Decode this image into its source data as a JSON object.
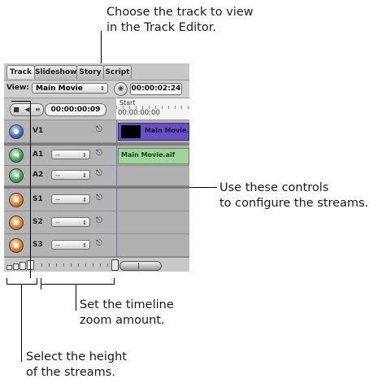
{
  "callouts": {
    "track_editor": [
      "Choose the track to view",
      "in the Track Editor."
    ],
    "configure_streams": [
      "Use these controls",
      "to configure the streams."
    ],
    "zoom": [
      "Set the timeline",
      "zoom amount."
    ],
    "height": [
      "Select the height",
      "of the streams."
    ]
  },
  "tabs": [
    "Track",
    "Slideshow",
    "Story",
    "Script"
  ],
  "view": {
    "label": "View:",
    "selected": "Main Movie",
    "timecode": "00:00:02:24"
  },
  "controls": {
    "timecode": "00:00:00:09"
  },
  "ruler": {
    "start_label": "Start",
    "timecode": "00:00:00:00"
  },
  "tracks": {
    "v1": {
      "name": "V1",
      "clip": "Main Movie.m"
    },
    "a1": {
      "name": "A1",
      "stream": "--",
      "clip": "Main Movie.aif"
    },
    "a2": {
      "name": "A2",
      "stream": "--"
    },
    "s1": {
      "name": "S1",
      "stream": "--"
    },
    "s2": {
      "name": "S2",
      "stream": "--"
    },
    "s3": {
      "name": "S3",
      "stream": "--"
    }
  },
  "colors": {
    "video_clip": "#6a4fc3",
    "audio_clip": "#9fd59c",
    "video_button": "#3d62c9",
    "audio_button": "#3f9e52",
    "subtitle_button": "#d9782b"
  }
}
